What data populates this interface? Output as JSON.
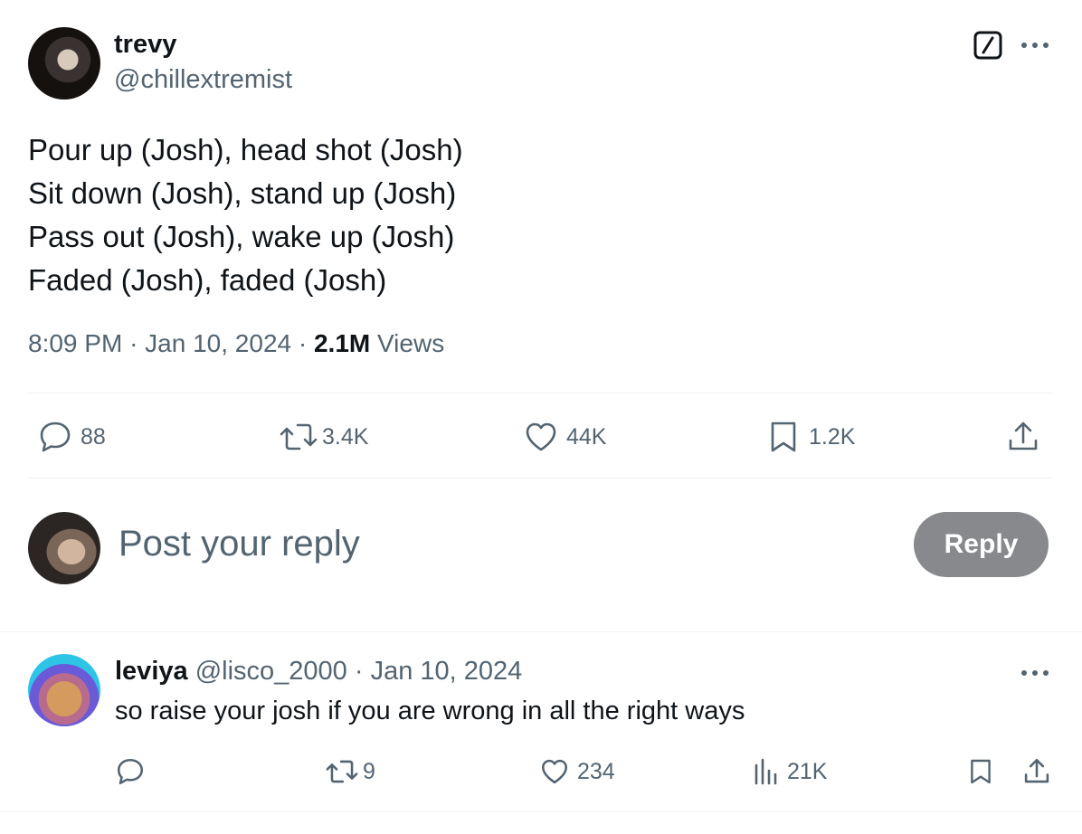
{
  "post": {
    "author_name": "trevy",
    "author_handle": "@chillextremist",
    "lines": [
      "Pour up (Josh), head shot (Josh)",
      "Sit down (Josh), stand up (Josh)",
      "Pass out (Josh), wake up (Josh)",
      "Faded (Josh), faded (Josh)"
    ],
    "time": "8:09 PM",
    "sep": "·",
    "date": "Jan 10, 2024",
    "views_count": "2.1M",
    "views_label": "Views",
    "actions": {
      "replies": "88",
      "reposts": "3.4K",
      "likes": "44K",
      "bookmarks": "1.2K"
    }
  },
  "compose": {
    "placeholder": "Post your reply",
    "reply_label": "Reply"
  },
  "reply": {
    "author_name": "leviya",
    "author_handle": "@lisco_2000",
    "sep": "·",
    "date": "Jan 10, 2024",
    "text": "so raise your josh if you are wrong in all the right ways",
    "actions": {
      "reposts": "9",
      "likes": "234",
      "views": "21K"
    }
  },
  "icons": {
    "more": "more-dots-icon",
    "grok": "grok-icon",
    "reply": "reply-bubble-icon",
    "repost": "repost-icon",
    "like": "heart-icon",
    "bookmark": "bookmark-icon",
    "share": "share-icon",
    "views": "views-bar-icon"
  },
  "colors": {
    "text": "#0f1419",
    "muted": "#536471",
    "divider": "#eff3f4",
    "reply_button": "#87898c"
  }
}
